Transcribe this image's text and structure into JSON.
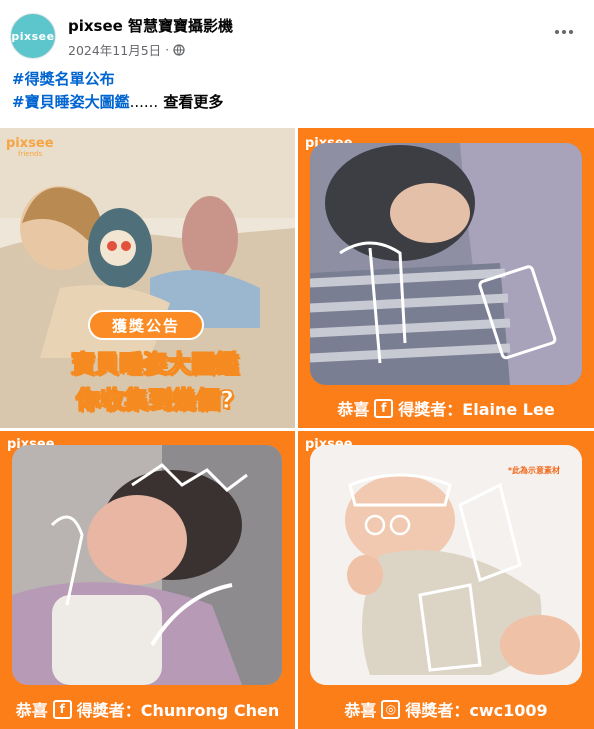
{
  "header": {
    "avatar_text": "pixsee",
    "page_name": "pixsee 智慧寶寶攝影機",
    "date": "2024年11月5日",
    "separator": "·",
    "audience_icon": "globe-icon",
    "more_icon": "more-options-icon"
  },
  "caption": {
    "tag1": "#得獎名單公布",
    "tag2": "#寶貝睡姿大圖鑑",
    "ellipsis": "......",
    "see_more": "查看更多"
  },
  "images": {
    "brand": "pixsee",
    "brand_sub": "friends",
    "cell1": {
      "badge": "獲獎公告",
      "headline_line1": "寶貝睡姿大圖鑑",
      "headline_line2": "你收集到幾個?"
    },
    "cell2": {
      "congrats": "恭喜",
      "social": "f",
      "winner_label": "得獎者：Elaine Lee"
    },
    "cell3": {
      "congrats": "恭喜",
      "social": "f",
      "winner_label": "得獎者：Chunrong Chen"
    },
    "cell4": {
      "note": "*此為示意素材",
      "congrats": "恭喜",
      "social": "◎",
      "winner_label": "得獎者：cwc1009"
    }
  },
  "colors": {
    "accent_orange": "#fb7e19",
    "hashtag_blue": "#0064d1",
    "avatar_teal": "#5cc6cc"
  }
}
